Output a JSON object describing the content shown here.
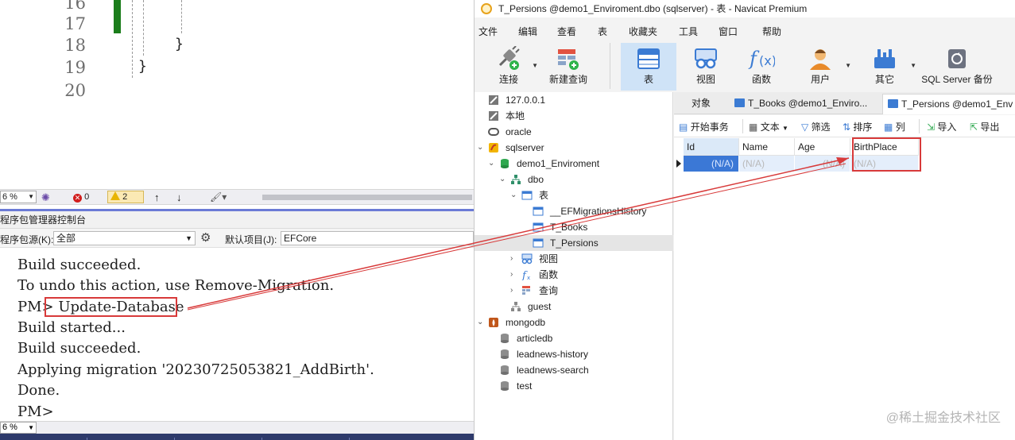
{
  "editor": {
    "line_numbers": [
      "16",
      "17",
      "18",
      "19",
      "20"
    ],
    "brace_inner": "}",
    "brace_outer": "}"
  },
  "vs_status": {
    "zoom": "6 %",
    "errors": "0",
    "warnings": "2"
  },
  "package_manager": {
    "title": "程序包管理器控制台",
    "source_label": "程序包源(K):",
    "source_value": "全部",
    "default_project_label": "默认项目(J):",
    "default_project_value": "EFCore",
    "zoom": "6 %",
    "console_lines": [
      "Build succeeded.",
      "To undo this action, use Remove-Migration.",
      "PM> Update-Database",
      "Build started...",
      "Build succeeded.",
      "Applying migration '20230725053821_AddBirth'.",
      "Done.",
      "PM>"
    ]
  },
  "navicat": {
    "window_title": "T_Persions @demo1_Enviroment.dbo (sqlserver) - 表 - Navicat Premium",
    "menu": [
      "文件",
      "编辑",
      "查看",
      "表",
      "收藏夹",
      "工具",
      "窗口",
      "帮助"
    ],
    "toolbar": [
      "连接",
      "新建查询",
      "表",
      "视图",
      "函数",
      "用户",
      "其它",
      "SQL Server 备份"
    ],
    "tree": [
      {
        "label": "127.0.0.1",
        "icon": "connection-icon"
      },
      {
        "label": "本地",
        "icon": "connection-icon"
      },
      {
        "label": "oracle",
        "icon": "oracle-icon"
      },
      {
        "label": "sqlserver",
        "icon": "sqlserver-icon"
      },
      {
        "label": "demo1_Enviroment",
        "icon": "database-icon"
      },
      {
        "label": "dbo",
        "icon": "schema-icon"
      },
      {
        "label": "表",
        "icon": "tables-icon"
      },
      {
        "label": "__EFMigrationsHistory",
        "icon": "table-icon"
      },
      {
        "label": "T_Books",
        "icon": "table-icon"
      },
      {
        "label": "T_Persions",
        "icon": "table-icon"
      },
      {
        "label": "视图",
        "icon": "view-icon"
      },
      {
        "label": "函数",
        "icon": "function-icon"
      },
      {
        "label": "查询",
        "icon": "query-icon"
      },
      {
        "label": "guest",
        "icon": "schema-icon"
      },
      {
        "label": "mongodb",
        "icon": "mongodb-icon"
      },
      {
        "label": "articledb",
        "icon": "mongo-database-icon"
      },
      {
        "label": "leadnews-history",
        "icon": "mongo-database-icon"
      },
      {
        "label": "leadnews-search",
        "icon": "mongo-database-icon"
      },
      {
        "label": "test",
        "icon": "mongo-database-icon"
      }
    ],
    "tabs": [
      "对象",
      "T_Books @demo1_Enviro...",
      "T_Persions @demo1_Env"
    ],
    "grid_toolbar": [
      "开始事务",
      "文本",
      "筛选",
      "排序",
      "列",
      "导入",
      "导出"
    ],
    "columns": [
      "Id",
      "Name",
      "Age",
      "BirthPlace"
    ],
    "row": [
      "(N/A)",
      "(N/A)",
      "(N/A)",
      "(N/A)"
    ],
    "watermark": "@稀土掘金技术社区"
  },
  "colors": {
    "highlight_red": "#d83a3a",
    "selected_blue": "#3b78d6",
    "toolbar_active": "#cfe3f7"
  }
}
